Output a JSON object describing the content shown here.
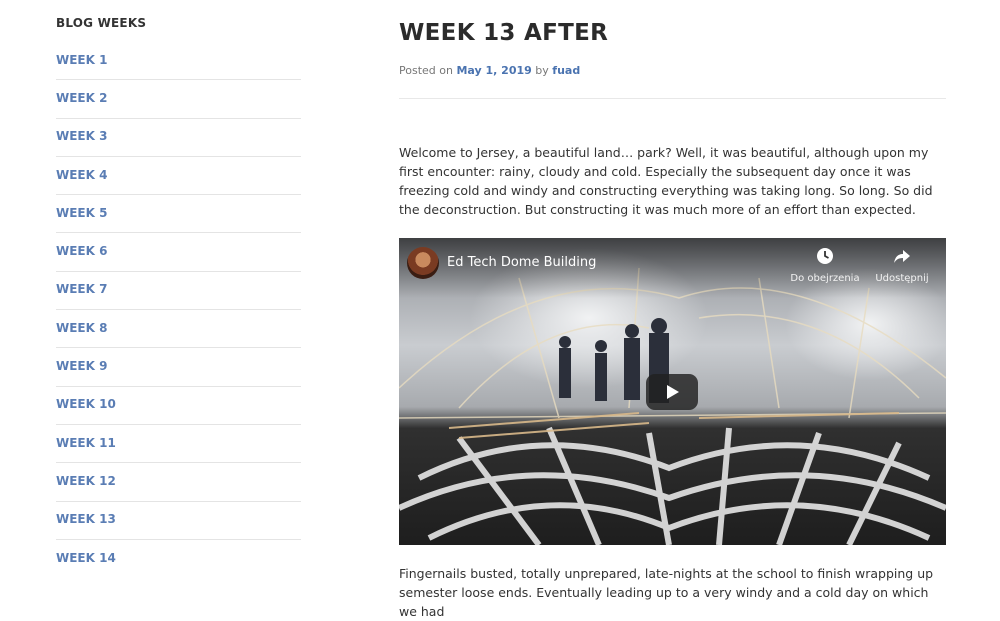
{
  "sidebar": {
    "title": "BLOG WEEKS",
    "items": [
      {
        "label": "WEEK 1"
      },
      {
        "label": "WEEK 2"
      },
      {
        "label": "WEEK 3"
      },
      {
        "label": "WEEK 4"
      },
      {
        "label": "WEEK 5"
      },
      {
        "label": "WEEK 6"
      },
      {
        "label": "WEEK 7"
      },
      {
        "label": "WEEK 8"
      },
      {
        "label": "WEEK 9"
      },
      {
        "label": "WEEK 10"
      },
      {
        "label": "WEEK 11"
      },
      {
        "label": "WEEK 12"
      },
      {
        "label": "WEEK 13"
      },
      {
        "label": "WEEK 14"
      }
    ]
  },
  "post": {
    "title": "WEEK 13 AFTER",
    "meta": {
      "posted_on": "Posted on",
      "date": "May 1, 2019",
      "by": "by",
      "author": "fuad"
    },
    "paragraph_1": "Welcome to Jersey, a beautiful land… park? Well, it was beautiful, although upon my first encounter: rainy, cloudy and cold. Especially the subsequent day once it was freezing cold and windy and constructing everything was taking long. So long. So did the deconstruction. But constructing it was much more of an effort than expected.",
    "paragraph_2": "Fingernails busted, totally unprepared, late-nights at the school to finish wrapping up semester loose ends. Eventually leading up to a very windy and a cold day on which we had"
  },
  "video": {
    "title": "Ed Tech Dome Building",
    "watch_later_label": "Do obejrzenia",
    "share_label": "Udostępnij",
    "icons": {
      "watch_later": "clock-icon",
      "share": "share-arrow-icon",
      "play": "play-icon"
    }
  },
  "colors": {
    "link": "#5a7db4",
    "title": "#2b2b2b",
    "divider": "#e4e4e4"
  }
}
